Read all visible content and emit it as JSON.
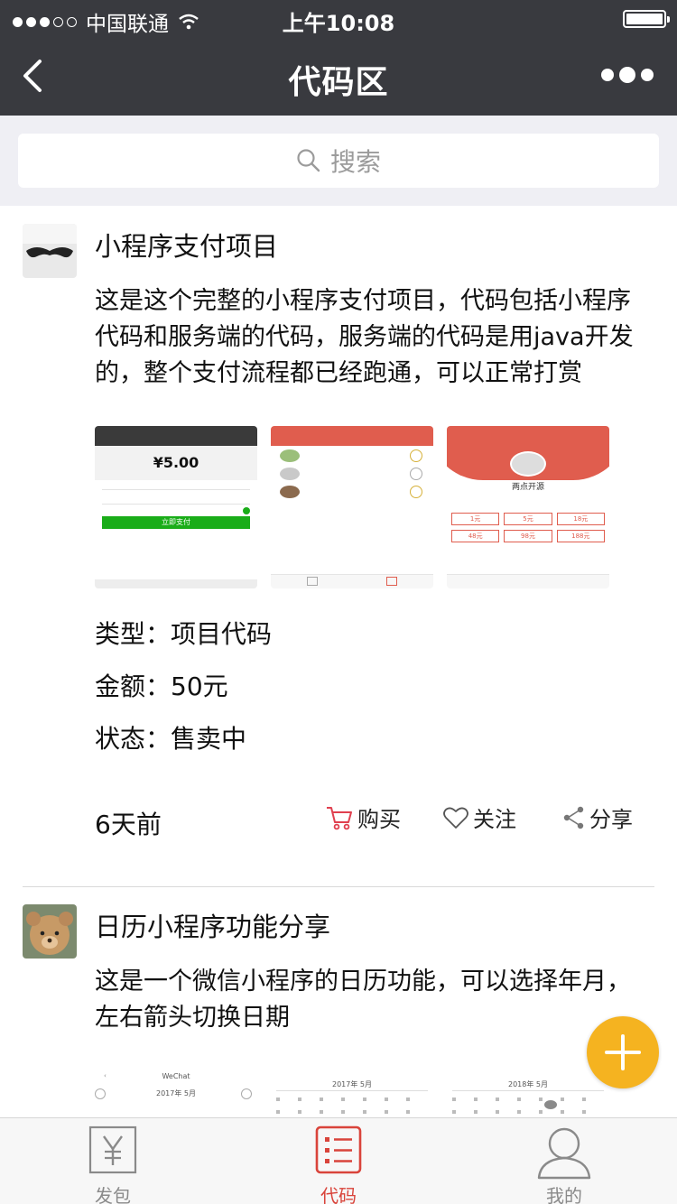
{
  "status_bar": {
    "carrier": "中国联通",
    "time": "上午10:08"
  },
  "nav": {
    "title": "代码区"
  },
  "search": {
    "placeholder": "搜索"
  },
  "posts": [
    {
      "title": "小程序支付项目",
      "description": "这是这个完整的小程序支付项目，代码包括小程序代码和服务端的代码，服务端的代码是用java开发的，整个支付流程都已经跑通，可以正常打赏",
      "thumb_texts": {
        "amount": "¥5.00",
        "pay_button": "立即支付",
        "brand": "两点开源",
        "options": [
          "1元",
          "5元",
          "18元",
          "48元",
          "98元",
          "188元"
        ]
      },
      "type": "类型：项目代码",
      "price": "金额：50元",
      "status": "状态：售卖中",
      "time": "6天前",
      "actions": {
        "buy": "购买",
        "follow": "关注",
        "share": "分享"
      }
    },
    {
      "title": "日历小程序功能分享",
      "description": "这是一个微信小程序的日历功能，可以选择年月，左右箭头切换日期",
      "thumb_texts": {
        "wechat": "WeChat",
        "month_1": "2017年 5月",
        "month_2": "2017年 5月",
        "month_3": "2018年 5月"
      }
    }
  ],
  "tabbar": {
    "items": [
      "发包",
      "代码",
      "我的"
    ],
    "active": "代码"
  },
  "colors": {
    "nav_bg": "#393a3f",
    "accent_red": "#d9443b",
    "fab": "#f5b320",
    "pay_green": "#1aad19"
  }
}
